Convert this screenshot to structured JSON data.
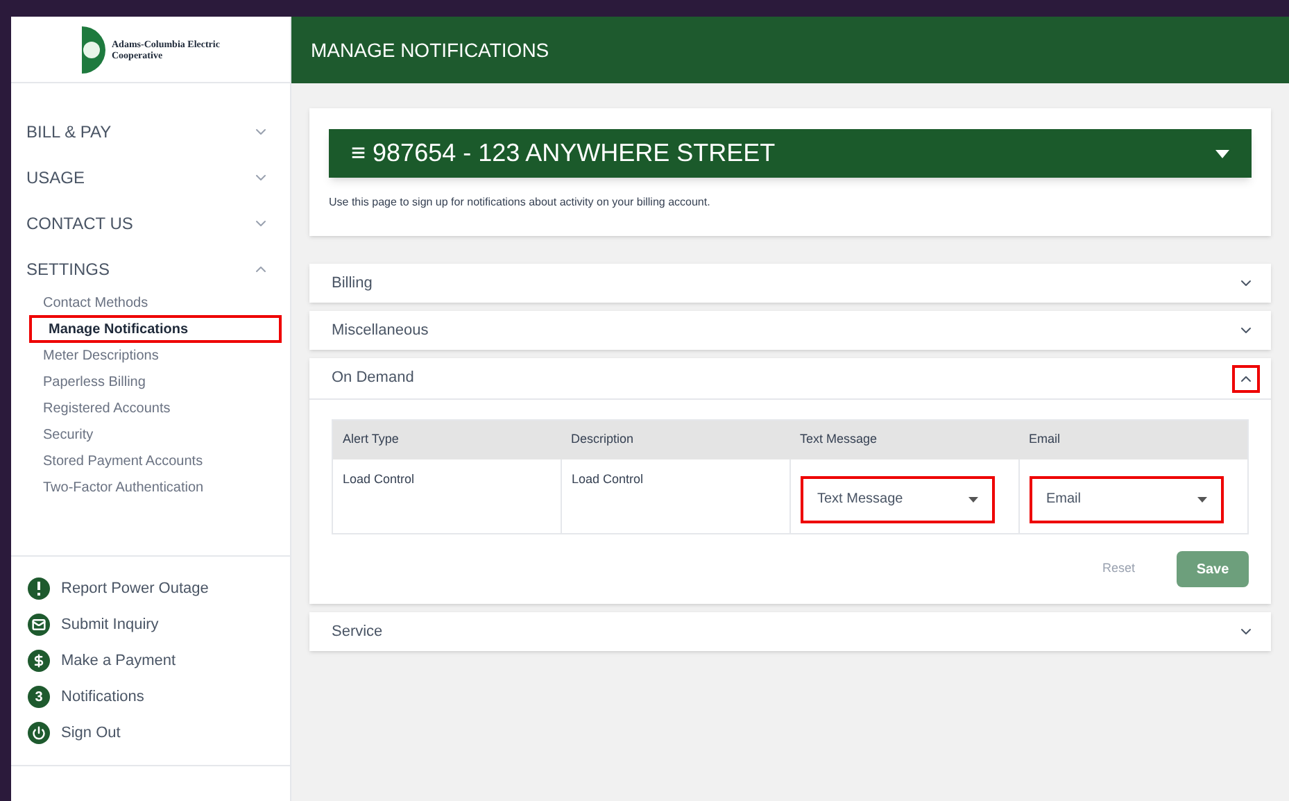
{
  "logo": {
    "name": "Adams-Columbia Electric Cooperative"
  },
  "header": {
    "title": "MANAGE NOTIFICATIONS"
  },
  "sidebar": {
    "sections": [
      {
        "label": "BILL & PAY",
        "expanded": false
      },
      {
        "label": "USAGE",
        "expanded": false
      },
      {
        "label": "CONTACT US",
        "expanded": false
      },
      {
        "label": "SETTINGS",
        "expanded": true,
        "children": [
          {
            "label": "Contact Methods",
            "selected": false,
            "highlighted": false
          },
          {
            "label": "Manage Notifications",
            "selected": true,
            "highlighted": true
          },
          {
            "label": "Meter Descriptions",
            "selected": false,
            "highlighted": false
          },
          {
            "label": "Paperless Billing",
            "selected": false,
            "highlighted": false
          },
          {
            "label": "Registered Accounts",
            "selected": false,
            "highlighted": false
          },
          {
            "label": "Security",
            "selected": false,
            "highlighted": false
          },
          {
            "label": "Stored Payment Accounts",
            "selected": false,
            "highlighted": false
          },
          {
            "label": "Two-Factor Authentication",
            "selected": false,
            "highlighted": false
          }
        ]
      }
    ],
    "quick_links": [
      {
        "kind": "alert",
        "label": "Report Power Outage"
      },
      {
        "kind": "mail",
        "label": "Submit Inquiry"
      },
      {
        "kind": "dollar",
        "label": "Make a Payment"
      },
      {
        "kind": "count",
        "badge": "3",
        "label": "Notifications"
      },
      {
        "kind": "power",
        "label": "Sign Out"
      }
    ]
  },
  "account": {
    "selector": "987654 - 123 ANYWHERE STREET",
    "icon": "≡",
    "intro": "Use this page to sign up for notifications about activity on your billing account."
  },
  "panels": [
    {
      "title": "Billing",
      "expanded": false,
      "highlighted": false
    },
    {
      "title": "Miscellaneous",
      "expanded": false,
      "highlighted": false
    },
    {
      "title": "On Demand",
      "expanded": true,
      "highlighted": true,
      "table": {
        "columns": [
          "Alert Type",
          "Description",
          "Text Message",
          "Email"
        ],
        "rows": [
          {
            "alert_type": "Load Control",
            "description": "Load Control",
            "text_message": {
              "value": "Text Message",
              "highlighted": true
            },
            "email": {
              "value": "Email",
              "highlighted": true
            }
          }
        ]
      },
      "buttons": {
        "reset": "Reset",
        "save": "Save"
      }
    },
    {
      "title": "Service",
      "expanded": false,
      "highlighted": false
    }
  ]
}
